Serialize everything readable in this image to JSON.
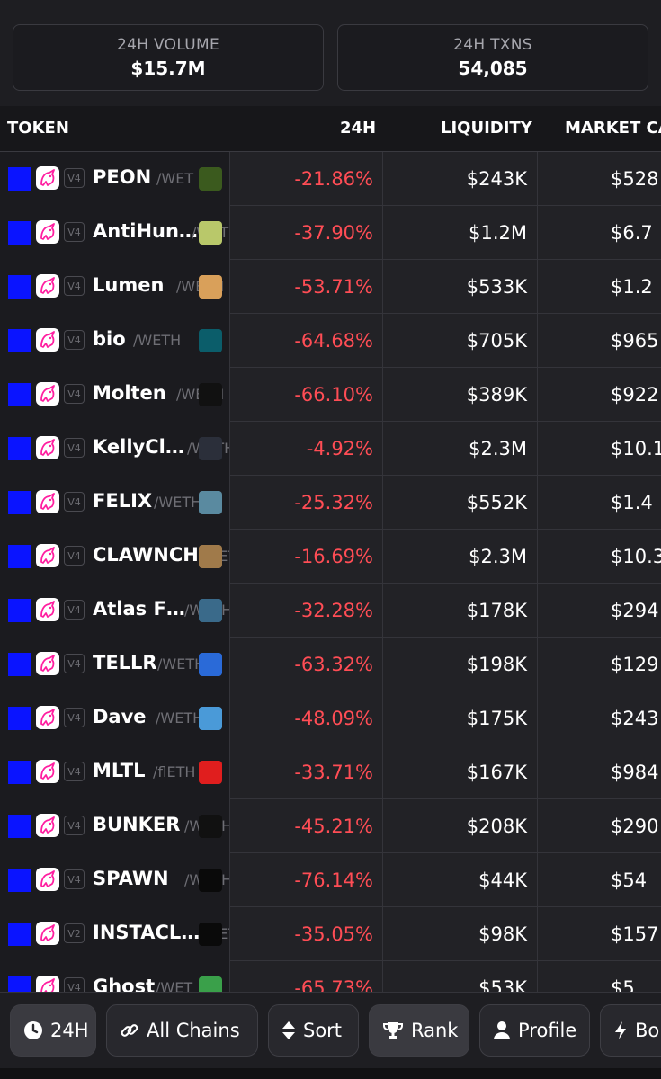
{
  "stats": {
    "volume_label": "24H VOLUME",
    "volume_value": "$15.7M",
    "txns_label": "24H TXNS",
    "txns_value": "54,085"
  },
  "table": {
    "headers": {
      "token": "TOKEN",
      "change": "24H",
      "liquidity": "LIQUIDITY",
      "mcap": "MARKET CA"
    },
    "rows": [
      {
        "name": "PEON",
        "pair": "/WET",
        "version": "V4",
        "change": "-21.86%",
        "liquidity": "$243K",
        "mcap": "$528",
        "logo_color": "#3b5a1e",
        "logo_icon": "goblin-logo-icon"
      },
      {
        "name": "AntiHun…",
        "pair": "/WETH",
        "version": "V4",
        "change": "-37.90%",
        "liquidity": "$1.2M",
        "mcap": "$6.7",
        "logo_color": "#b9c86a",
        "logo_icon": "dragon-logo-icon"
      },
      {
        "name": "Lumen",
        "pair": "/WETH",
        "version": "V4",
        "change": "-53.71%",
        "liquidity": "$533K",
        "mcap": "$1.2",
        "logo_color": "#d9a05a",
        "logo_icon": "orb-logo-icon"
      },
      {
        "name": "bio",
        "pair": "/WETH",
        "version": "V4",
        "change": "-64.68%",
        "liquidity": "$705K",
        "mcap": "$965",
        "logo_color": "#0b5d6a",
        "logo_icon": "eye-logo-icon"
      },
      {
        "name": "Molten",
        "pair": "/WETH",
        "version": "V4",
        "change": "-66.10%",
        "liquidity": "$389K",
        "mcap": "$922",
        "logo_color": "#111111",
        "logo_icon": "triangle-logo-icon"
      },
      {
        "name": "KellyCl…",
        "pair": "/WETH",
        "version": "V4",
        "change": "-4.92%",
        "liquidity": "$2.3M",
        "mcap": "$10.1",
        "logo_color": "#2b2f3a",
        "logo_icon": "k-logo-icon"
      },
      {
        "name": "FELIX",
        "pair": "/WETH",
        "version": "V4",
        "change": "-25.32%",
        "liquidity": "$552K",
        "mcap": "$1.4",
        "logo_color": "#5a8aa0",
        "logo_icon": "pixel-avatar-logo-icon"
      },
      {
        "name": "CLAWNCH",
        "pair": "/WETH",
        "version": "V4",
        "change": "-16.69%",
        "liquidity": "$2.3M",
        "mcap": "$10.3",
        "logo_color": "#a07a4a",
        "logo_icon": "coin-logo-icon"
      },
      {
        "name": "Atlas F…",
        "pair": "/WETH",
        "version": "V4",
        "change": "-32.28%",
        "liquidity": "$178K",
        "mcap": "$294",
        "logo_color": "#3a6a8a",
        "logo_icon": "pixel-face-logo-icon"
      },
      {
        "name": "TELLR",
        "pair": "/WETH",
        "version": "V4",
        "change": "-63.32%",
        "liquidity": "$198K",
        "mcap": "$129",
        "logo_color": "#2a6ad8",
        "logo_icon": "robot-logo-icon"
      },
      {
        "name": "Dave",
        "pair": "/WETH",
        "version": "V4",
        "change": "-48.09%",
        "liquidity": "$175K",
        "mcap": "$243",
        "logo_color": "#4a9ad8",
        "logo_icon": "minion-logo-icon"
      },
      {
        "name": "MLTL",
        "pair": "/flETH",
        "version": "V4",
        "change": "-33.71%",
        "liquidity": "$167K",
        "mcap": "$984",
        "logo_color": "#e01e1e",
        "logo_icon": "m-logo-icon"
      },
      {
        "name": "BUNKER",
        "pair": "/WETH",
        "version": "V4",
        "change": "-45.21%",
        "liquidity": "$208K",
        "mcap": "$290",
        "logo_color": "#111111",
        "logo_icon": "raccoon-logo-icon"
      },
      {
        "name": "SPAWN",
        "pair": "/WETH",
        "version": "V4",
        "change": "-76.14%",
        "liquidity": "$44K",
        "mcap": "$54",
        "logo_color": "#0a0a0a",
        "logo_icon": "ring-logo-icon"
      },
      {
        "name": "INSTACL…",
        "pair": "/WETH",
        "version": "V2",
        "change": "-35.05%",
        "liquidity": "$98K",
        "mcap": "$157",
        "logo_color": "#0a0a0a",
        "logo_icon": "crab-logo-icon"
      },
      {
        "name": "Ghost",
        "pair": "/WET",
        "version": "V4",
        "change": "-65.73%",
        "liquidity": "$53K",
        "mcap": "$5",
        "logo_color": "#3aa04a",
        "logo_icon": "frog-logo-icon"
      }
    ]
  },
  "bottom_bar": {
    "time": "24H",
    "chains": "All Chains",
    "sort": "Sort",
    "rank": "Rank",
    "profile": "Profile",
    "boost": "Bo"
  },
  "colors": {
    "negative": "#ff4d55",
    "chain": "#0a14ff",
    "dex": "#ff1ea0"
  }
}
